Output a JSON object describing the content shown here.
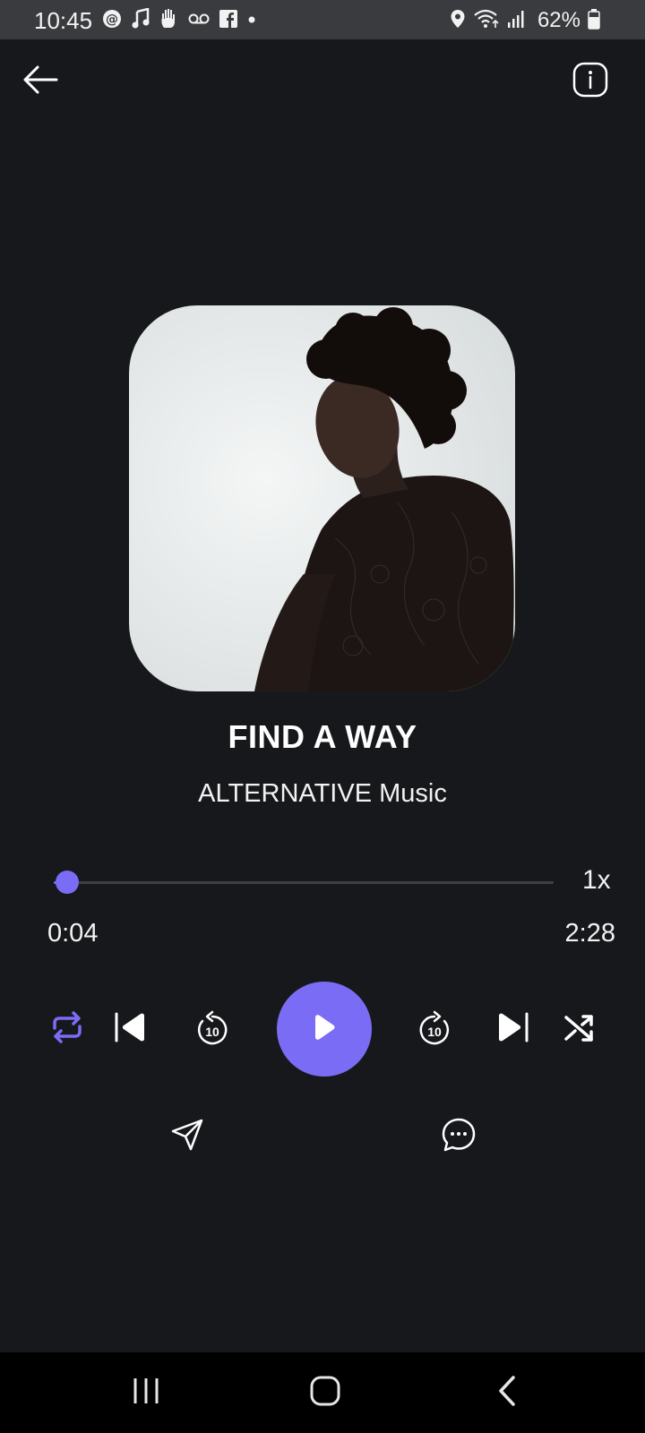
{
  "status_bar": {
    "time": "10:45",
    "battery": "62%",
    "left_icons": [
      "threads-icon",
      "music-note-icon",
      "hand-icon",
      "voicemail-icon",
      "facebook-icon",
      "dot-icon"
    ],
    "right_icons": [
      "location-icon",
      "wifi-icon",
      "signal-icon",
      "battery-icon"
    ]
  },
  "toolbar": {
    "back_icon": "arrow-left-icon",
    "info_icon": "info-icon"
  },
  "track": {
    "title": "FIND A WAY",
    "artist": "ALTERNATIVE Music",
    "artwork": "album-art"
  },
  "player": {
    "elapsed": "0:04",
    "duration": "2:28",
    "progress_fraction": 0.027,
    "speed": "1x",
    "controls": [
      "repeat-icon",
      "previous-icon",
      "rewind-10-icon",
      "play-icon",
      "forward-10-icon",
      "next-icon",
      "shuffle-icon"
    ],
    "rewind_label": "10",
    "forward_label": "10"
  },
  "actions": [
    "share-icon",
    "comment-icon"
  ],
  "nav": [
    "recent-apps-icon",
    "home-icon",
    "back-nav-icon"
  ],
  "colors": {
    "accent": "#7b6cf6",
    "background": "#17181b",
    "status_bar": "#3a3b3e"
  }
}
